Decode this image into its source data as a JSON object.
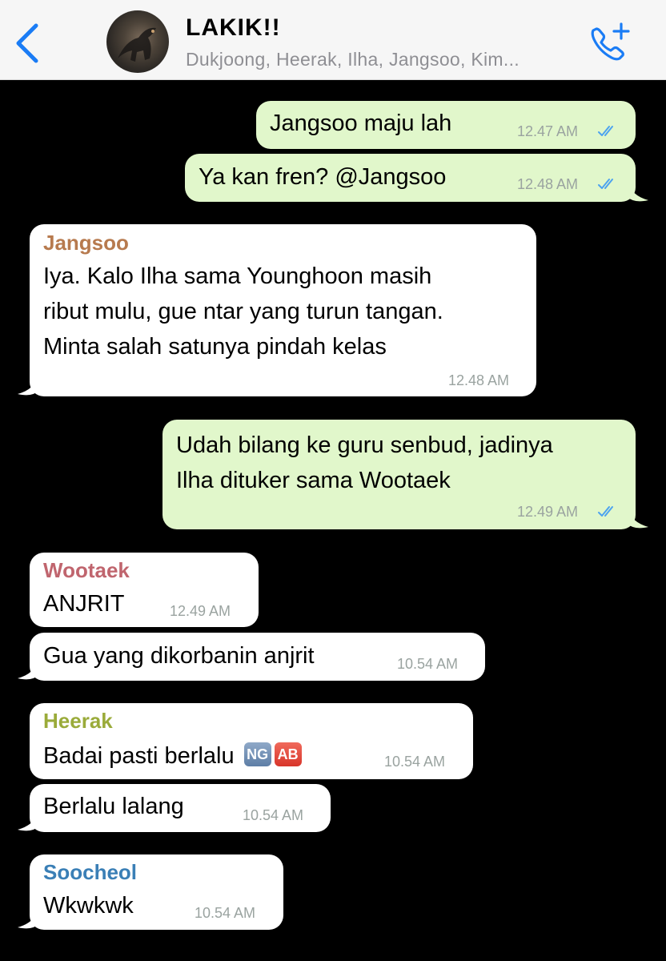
{
  "header": {
    "title": "LAKIK!!",
    "subtitle": "Dukjoong, Heerak, Ilha, Jangsoo, Kim..."
  },
  "colors": {
    "outgoing_bubble": "#e1f7cb",
    "incoming_bubble": "#ffffff",
    "ios_blue": "#1a7cf5",
    "sender_jangsoo": "#b77a4e",
    "sender_wootaek": "#c0656e",
    "sender_heerak": "#9aab3a",
    "sender_soocheol": "#3a7fb6"
  },
  "messages": [
    {
      "direction": "outgoing",
      "text": "Jangsoo maju lah",
      "time": "12.47 AM",
      "status": "read"
    },
    {
      "direction": "outgoing",
      "text": "Ya kan fren? @Jangsoo",
      "time": "12.48 AM",
      "status": "read"
    },
    {
      "direction": "incoming",
      "sender": "Jangsoo",
      "lines": [
        "Iya. Kalo Ilha sama Younghoon masih",
        "ribut mulu, gue ntar yang turun tangan.",
        "Minta salah satunya pindah kelas"
      ],
      "time": "12.48 AM"
    },
    {
      "direction": "outgoing",
      "lines": [
        "Udah bilang ke guru senbud, jadinya",
        "Ilha dituker sama Wootaek"
      ],
      "time": "12.49 AM",
      "status": "read"
    },
    {
      "direction": "incoming",
      "sender": "Wootaek",
      "text": "ANJRIT",
      "time": "12.49 AM"
    },
    {
      "direction": "incoming",
      "text": "Gua yang dikorbanin anjrit",
      "time": "10.54 AM"
    },
    {
      "direction": "incoming",
      "sender": "Heerak",
      "text": "Badai pasti berlalu",
      "emojis": [
        "NG",
        "AB"
      ],
      "time": "10.54 AM"
    },
    {
      "direction": "incoming",
      "text": "Berlalu lalang",
      "time": "10.54 AM"
    },
    {
      "direction": "incoming",
      "sender": "Soocheol",
      "text": "Wkwkwk",
      "time": "10.54 AM"
    }
  ]
}
